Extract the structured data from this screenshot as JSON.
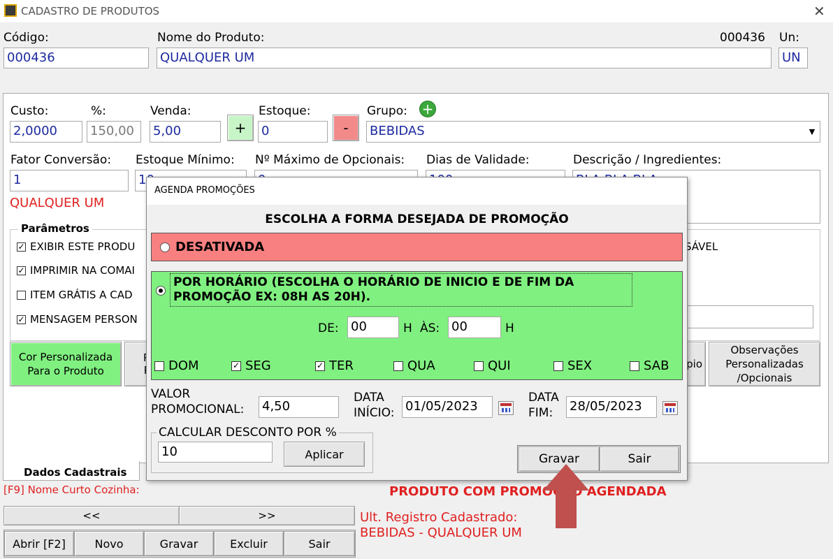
{
  "window": {
    "title": "CADASTRO DE PRODUTOS"
  },
  "header": {
    "codigo_label": "Código:",
    "codigo_value": "000436",
    "nome_label": "Nome do Produto:",
    "nome_value": "QUALQUER UM",
    "code_display": "000436",
    "un_label": "Un:",
    "un_value": "UN"
  },
  "form": {
    "custo_label": "Custo:",
    "custo_value": "2,0000",
    "pct_label": "%:",
    "pct_value": "150,00",
    "venda_label": "Venda:",
    "venda_value": "5,00",
    "plus_label": "+",
    "estoque_label": "Estoque:",
    "estoque_value": "0",
    "minus_label": "-",
    "grupo_label": "Grupo:",
    "grupo_value": "BEBIDAS",
    "fator_label": "Fator Conversão:",
    "fator_value": "1",
    "estoque_min_label": "Estoque Mínimo:",
    "estoque_min_value": "10",
    "max_opc_label": "Nº Máximo de Opcionais:",
    "max_opc_value": "0",
    "dias_label": "Dias de Validade:",
    "dias_value": "100",
    "desc_label": "Descrição / Ingredientes:",
    "desc_value": "BLA BLA BLA",
    "product_name_red": "QUALQUER UM"
  },
  "parametros": {
    "title": "Parâmetros",
    "items": [
      {
        "label": "EXIBIR ESTE PRODU",
        "checked": true
      },
      {
        "label": "IMPRIMIR NA COMAI",
        "checked": true
      },
      {
        "label": "ITEM GRÁTIS A CAD",
        "checked": false
      },
      {
        "label": "MENSAGEM PERSON",
        "checked": true
      }
    ],
    "right_text": "SÁVEL"
  },
  "side_buttons": {
    "cor": "Cor Personalizada Para o Produto",
    "partial_left": "R\nP",
    "partial_right": "pio",
    "obs": "Observações Personalizadas /Opcionais"
  },
  "tabs": {
    "active": "Dados Cadastrais"
  },
  "footer": {
    "f9": "[F9] Nome Curto Cozinha:",
    "promo_notice": "PRODUTO COM PROMOÇÃO AGENDADA",
    "prev": "<<",
    "next": ">>",
    "ult_label": "Ult. Registro Cadastrado:",
    "ult_value": "BEBIDAS - QUALQUER UM",
    "abrir": "Abrir [F2]",
    "novo": "Novo",
    "gravar": "Gravar",
    "excluir": "Excluir",
    "sair": "Sair"
  },
  "dialog": {
    "title": "AGENDA PROMOÇÕES",
    "heading": "ESCOLHA A FORMA DESEJADA DE PROMOÇÃO",
    "option_off": "DESATIVADA",
    "option_hour": "POR HORÁRIO (ESCOLHA O HORÁRIO DE INICIO E DE FIM DA PROMOÇÃO EX: 08H  AS 20H).",
    "de_label": "DE:",
    "de_value": "00",
    "h1": "H",
    "as_label": "ÀS:",
    "as_value": "00",
    "h2": "H",
    "days": [
      {
        "label": "DOM",
        "checked": false
      },
      {
        "label": "SEG",
        "checked": true
      },
      {
        "label": "TER",
        "checked": true
      },
      {
        "label": "QUA",
        "checked": false
      },
      {
        "label": "QUI",
        "checked": false
      },
      {
        "label": "SEX",
        "checked": false
      },
      {
        "label": "SAB",
        "checked": false
      }
    ],
    "valor_label_1": "VALOR",
    "valor_label_2": "PROMOCIONAL:",
    "valor_value": "4,50",
    "data_inicio_1": "DATA",
    "data_inicio_2": "INÍCIO:",
    "data_inicio_value": "01/05/2023",
    "data_fim_1": "DATA",
    "data_fim_2": "FIM:",
    "data_fim_value": "28/05/2023",
    "desconto_legend": "CALCULAR DESCONTO POR %",
    "desconto_value": "10",
    "aplicar": "Aplicar",
    "gravar": "Gravar",
    "sair": "Sair"
  },
  "colors": {
    "green": "#80f080",
    "red": "#f88080",
    "arrow": "#c0504d",
    "notice": "#e02020"
  }
}
